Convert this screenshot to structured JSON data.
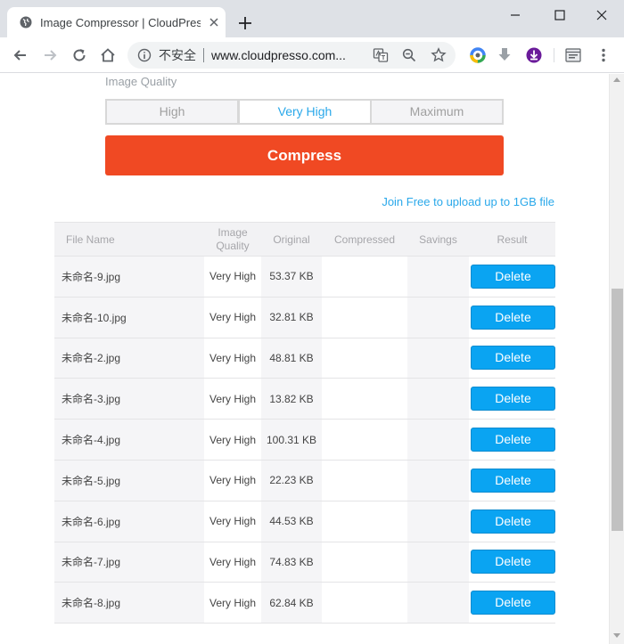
{
  "browser": {
    "tab_title": "Image Compressor | CloudPresso",
    "omnibox": {
      "security_text": "不安全",
      "url": "www.cloudpresso.com..."
    }
  },
  "colors": {
    "accent": "#29a8ea",
    "compress_button": "#f04923",
    "delete_button": "#0aa4f2"
  },
  "page": {
    "quality_label": "Image Quality",
    "quality_options": [
      "High",
      "Very High",
      "Maximum"
    ],
    "selected_quality": "Very High",
    "compress_label": "Compress",
    "join_link": "Join Free to upload up to 1GB file",
    "table": {
      "headers": {
        "file_name": "File Name",
        "image_quality_line1": "Image",
        "image_quality_line2": "Quality",
        "original": "Original",
        "compressed": "Compressed",
        "savings": "Savings",
        "result": "Result"
      },
      "rows": [
        {
          "name": "未命名-9.jpg",
          "quality": "Very High",
          "original": "53.37 KB",
          "compressed": "",
          "savings": "",
          "action": "Delete"
        },
        {
          "name": "未命名-10.jpg",
          "quality": "Very High",
          "original": "32.81 KB",
          "compressed": "",
          "savings": "",
          "action": "Delete"
        },
        {
          "name": "未命名-2.jpg",
          "quality": "Very High",
          "original": "48.81 KB",
          "compressed": "",
          "savings": "",
          "action": "Delete"
        },
        {
          "name": "未命名-3.jpg",
          "quality": "Very High",
          "original": "13.82 KB",
          "compressed": "",
          "savings": "",
          "action": "Delete"
        },
        {
          "name": "未命名-4.jpg",
          "quality": "Very High",
          "original": "100.31 KB",
          "compressed": "",
          "savings": "",
          "action": "Delete"
        },
        {
          "name": "未命名-5.jpg",
          "quality": "Very High",
          "original": "22.23 KB",
          "compressed": "",
          "savings": "",
          "action": "Delete"
        },
        {
          "name": "未命名-6.jpg",
          "quality": "Very High",
          "original": "44.53 KB",
          "compressed": "",
          "savings": "",
          "action": "Delete"
        },
        {
          "name": "未命名-7.jpg",
          "quality": "Very High",
          "original": "74.83 KB",
          "compressed": "",
          "savings": "",
          "action": "Delete"
        },
        {
          "name": "未命名-8.jpg",
          "quality": "Very High",
          "original": "62.84 KB",
          "compressed": "",
          "savings": "",
          "action": "Delete"
        }
      ]
    }
  }
}
